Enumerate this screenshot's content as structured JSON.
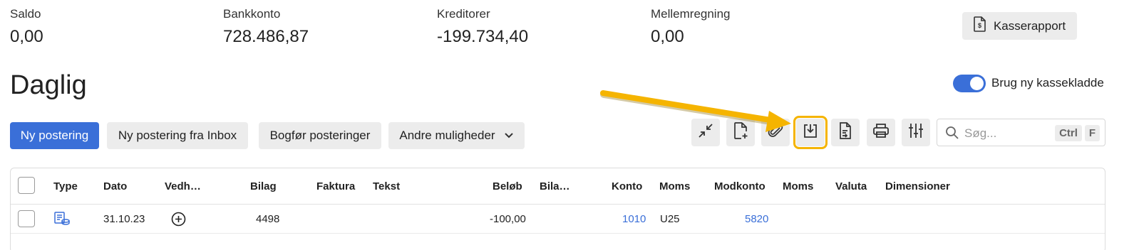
{
  "summary": [
    {
      "label": "Saldo",
      "value": "0,00"
    },
    {
      "label": "Bankkonto",
      "value": "728.486,87"
    },
    {
      "label": "Kreditorer",
      "value": "-199.734,40"
    },
    {
      "label": "Mellemregning",
      "value": "0,00"
    }
  ],
  "kasserapport_label": "Kasserapport",
  "page_title": "Daglig",
  "toggle": {
    "label": "Brug ny kassekladde",
    "on": true
  },
  "actions": {
    "new_entry": "Ny postering",
    "new_from_inbox": "Ny postering fra Inbox",
    "post_entries": "Bogfør posteringer",
    "other_options": "Andre muligheder"
  },
  "toolbar_icons": [
    "collapse-icon",
    "new-document-icon",
    "attach-icon",
    "download-icon",
    "document-arrow-icon",
    "print-icon",
    "column-settings-icon"
  ],
  "search": {
    "placeholder": "Søg...",
    "shortcut_ctrl": "Ctrl",
    "shortcut_key": "F"
  },
  "table": {
    "columns": {
      "type": "Type",
      "dato": "Dato",
      "vedh": "Vedh…",
      "bilag": "Bilag",
      "faktura": "Faktura",
      "tekst": "Tekst",
      "belob": "Beløb",
      "bila2": "Bila…",
      "konto": "Konto",
      "moms": "Moms",
      "modkonto": "Modkonto",
      "moms2": "Moms",
      "valuta": "Valuta",
      "dimensioner": "Dimensioner"
    },
    "rows": [
      {
        "dato": "31.10.23",
        "bilag": "4498",
        "belob": "-100,00",
        "konto": "1010",
        "moms": "U25",
        "modkonto": "5820"
      }
    ]
  },
  "colors": {
    "accent": "#3a6fd8",
    "highlight": "#f5b400"
  }
}
